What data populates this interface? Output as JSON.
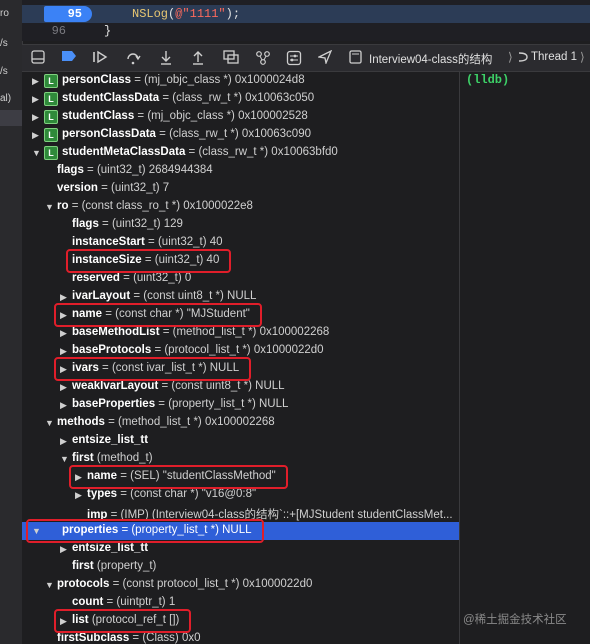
{
  "gutter": {
    "items": [
      "ro",
      "/s",
      "/s",
      "al)"
    ]
  },
  "code": {
    "prev_line_number": "94",
    "current_line_number": "95",
    "current_line_fn": "NSLog",
    "current_line_paren_open": "(",
    "current_line_string": "@\"1111\"",
    "current_line_tail": ");",
    "next_line_number": "96",
    "next_line_text": "}"
  },
  "toolbar": {
    "icons": [
      "hide-debug-area-icon",
      "breakpoints-toggle-icon",
      "continue-icon",
      "step-over-icon",
      "step-into-icon",
      "step-out-icon",
      "view-hierarchy-icon",
      "memory-graph-icon",
      "environment-overrides-icon",
      "location-icon"
    ],
    "breadcrumb_target": "Interview04-class的结构",
    "breadcrumb_thread": "Thread 1",
    "separator": "⟩"
  },
  "variables": [
    {
      "indent": 0,
      "expand": "collapsed",
      "badge": "L",
      "name": "personClass",
      "value": " = (mj_objc_class *) 0x1000024d8"
    },
    {
      "indent": 0,
      "expand": "collapsed",
      "badge": "L",
      "name": "studentClassData",
      "value": " = (class_rw_t *) 0x10063c050"
    },
    {
      "indent": 0,
      "expand": "collapsed",
      "badge": "L",
      "name": "studentClass",
      "value": " = (mj_objc_class *) 0x100002528"
    },
    {
      "indent": 0,
      "expand": "collapsed",
      "badge": "L",
      "name": "personClassData",
      "value": " = (class_rw_t *) 0x10063c090"
    },
    {
      "indent": 0,
      "expand": "expanded",
      "badge": "L",
      "name": "studentMetaClassData",
      "value": " = (class_rw_t *) 0x10063bfd0"
    },
    {
      "indent": 1,
      "expand": "none",
      "badge": "",
      "name": "flags",
      "value": " = (uint32_t) 2684944384"
    },
    {
      "indent": 1,
      "expand": "none",
      "badge": "",
      "name": "version",
      "value": " = (uint32_t) 7"
    },
    {
      "indent": 1,
      "expand": "expanded",
      "badge": "",
      "name": "ro",
      "value": " = (const class_ro_t *) 0x1000022e8"
    },
    {
      "indent": 2,
      "expand": "none",
      "badge": "",
      "name": "flags",
      "value": " = (uint32_t) 129"
    },
    {
      "indent": 2,
      "expand": "none",
      "badge": "",
      "name": "instanceStart",
      "value": " = (uint32_t) 40"
    },
    {
      "indent": 2,
      "expand": "none",
      "badge": "",
      "name": "instanceSize",
      "value": " = (uint32_t) 40"
    },
    {
      "indent": 2,
      "expand": "none",
      "badge": "",
      "name": "reserved",
      "value": " = (uint32_t) 0"
    },
    {
      "indent": 2,
      "expand": "collapsed",
      "badge": "",
      "name": "ivarLayout",
      "value": " = (const uint8_t *) NULL"
    },
    {
      "indent": 2,
      "expand": "collapsed",
      "badge": "",
      "name": "name",
      "value": " = (const char *) \"MJStudent\""
    },
    {
      "indent": 2,
      "expand": "collapsed",
      "badge": "",
      "name": "baseMethodList",
      "value": " = (method_list_t *) 0x100002268"
    },
    {
      "indent": 2,
      "expand": "collapsed",
      "badge": "",
      "name": "baseProtocols",
      "value": " = (protocol_list_t *) 0x1000022d0"
    },
    {
      "indent": 2,
      "expand": "collapsed",
      "badge": "",
      "name": "ivars",
      "value": " = (const ivar_list_t *) NULL"
    },
    {
      "indent": 2,
      "expand": "collapsed",
      "badge": "",
      "name": "weakIvarLayout",
      "value": " = (const uint8_t *) NULL"
    },
    {
      "indent": 2,
      "expand": "collapsed",
      "badge": "",
      "name": "baseProperties",
      "value": " = (property_list_t *) NULL"
    },
    {
      "indent": 1,
      "expand": "expanded",
      "badge": "",
      "name": "methods",
      "value": " = (method_list_t *) 0x100002268"
    },
    {
      "indent": 2,
      "expand": "collapsed",
      "badge": "",
      "name": "entsize_list_tt",
      "value": ""
    },
    {
      "indent": 2,
      "expand": "expanded",
      "badge": "",
      "name": "first",
      "value": " (method_t)"
    },
    {
      "indent": 3,
      "expand": "collapsed",
      "badge": "",
      "name": "name",
      "value": " = (SEL) \"studentClassMethod\""
    },
    {
      "indent": 3,
      "expand": "collapsed",
      "badge": "",
      "name": "types",
      "value": " = (const char *) \"v16@0:8\""
    },
    {
      "indent": 3,
      "expand": "none",
      "badge": "",
      "name": "imp",
      "value": " = (IMP) (Interview04-class的结构`::+[MJStudent studentClassMet..."
    },
    {
      "indent": 0,
      "expand": "expanded",
      "badge": "",
      "name": "properties",
      "value": " = (property_list_t *) NULL",
      "selected": true
    },
    {
      "indent": 2,
      "expand": "collapsed",
      "badge": "",
      "name": "entsize_list_tt",
      "value": ""
    },
    {
      "indent": 2,
      "expand": "none",
      "badge": "",
      "name": "first",
      "value": " (property_t)"
    },
    {
      "indent": 1,
      "expand": "expanded",
      "badge": "",
      "name": "protocols",
      "value": " = (const protocol_list_t *) 0x1000022d0"
    },
    {
      "indent": 2,
      "expand": "none",
      "badge": "",
      "name": "count",
      "value": " = (uintptr_t) 1"
    },
    {
      "indent": 2,
      "expand": "collapsed",
      "badge": "",
      "name": "list",
      "value": " (protocol_ref_t [])"
    },
    {
      "indent": 1,
      "expand": "none",
      "badge": "",
      "name": "firstSubclass",
      "value": " = (Class) 0x0"
    }
  ],
  "highlights": [
    10,
    13,
    16,
    22,
    25,
    30
  ],
  "console": {
    "prompt": "(lldb)"
  },
  "watermark": "@稀土掘金技术社区",
  "colors": {
    "selection": "#2f5fd8",
    "highlight_box": "#e01e2a",
    "badge_green": "#2f8a3a",
    "prompt_green": "#3dd067",
    "line_badge_blue": "#3b82f6"
  }
}
